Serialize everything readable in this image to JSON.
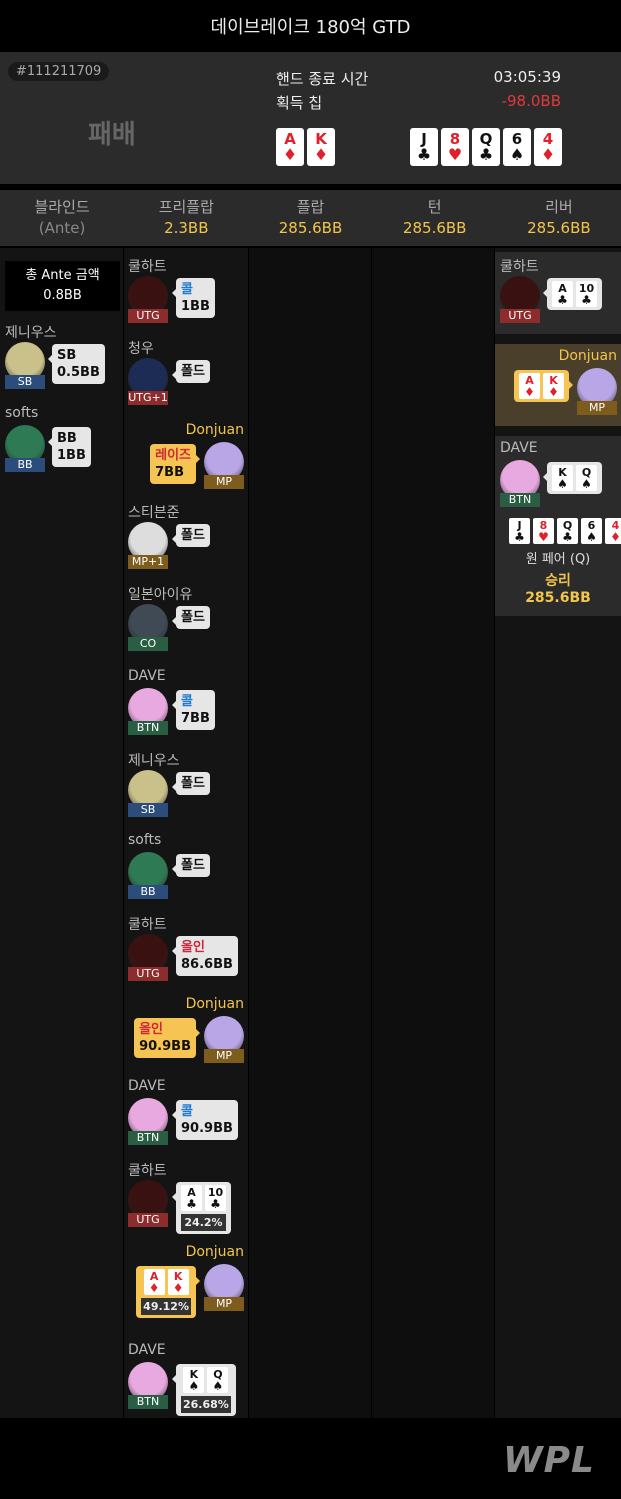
{
  "header": {
    "title": "데이브레이크 180억 GTD"
  },
  "summary": {
    "hand_id": "#111211709",
    "result": "패배",
    "end_time_label": "핸드 종료 시간",
    "end_time": "03:05:39",
    "chips_label": "획득 칩",
    "chips": "-98.0BB",
    "hole_cards": [
      {
        "rank": "A",
        "suit": "♦",
        "color": "red"
      },
      {
        "rank": "K",
        "suit": "♦",
        "color": "red"
      }
    ],
    "board": [
      {
        "rank": "J",
        "suit": "♣",
        "color": "black"
      },
      {
        "rank": "8",
        "suit": "♥",
        "color": "red"
      },
      {
        "rank": "Q",
        "suit": "♣",
        "color": "black"
      },
      {
        "rank": "6",
        "suit": "♠",
        "color": "black"
      },
      {
        "rank": "4",
        "suit": "♦",
        "color": "red"
      }
    ]
  },
  "streets": [
    {
      "name": "블라인드",
      "amount": "(Ante)"
    },
    {
      "name": "프리플랍",
      "amount": "2.3BB"
    },
    {
      "name": "플랍",
      "amount": "285.6BB"
    },
    {
      "name": "턴",
      "amount": "285.6BB"
    },
    {
      "name": "리버",
      "amount": "285.6BB"
    }
  ],
  "blinds": {
    "ante_label": "총 Ante 금액",
    "ante_value": "0.8BB",
    "players": [
      {
        "name": "제니우스",
        "pos": "SB",
        "action": "SB",
        "amount": "0.5BB"
      },
      {
        "name": "softs",
        "pos": "BB",
        "action": "BB",
        "amount": "1BB"
      }
    ]
  },
  "preflop": [
    {
      "name": "쿨하트",
      "pos": "UTG",
      "action": "콜",
      "amount": "1BB"
    },
    {
      "name": "청우",
      "pos": "UTG+1",
      "action": "폴드",
      "amount": ""
    },
    {
      "name": "Donjuan",
      "pos": "MP",
      "action": "레이즈",
      "amount": "7BB"
    },
    {
      "name": "스티븐준",
      "pos": "MP+1",
      "action": "폴드",
      "amount": ""
    },
    {
      "name": "일본아이유",
      "pos": "CO",
      "action": "폴드",
      "amount": ""
    },
    {
      "name": "DAVE",
      "pos": "BTN",
      "action": "콜",
      "amount": "7BB"
    },
    {
      "name": "제니우스",
      "pos": "SB",
      "action": "폴드",
      "amount": ""
    },
    {
      "name": "softs",
      "pos": "BB",
      "action": "폴드",
      "amount": ""
    },
    {
      "name": "쿨하트",
      "pos": "UTG",
      "action": "올인",
      "amount": "86.6BB"
    },
    {
      "name": "Donjuan",
      "pos": "MP",
      "action": "올인",
      "amount": "90.9BB"
    },
    {
      "name": "DAVE",
      "pos": "BTN",
      "action": "콜",
      "amount": "90.9BB"
    },
    {
      "name": "쿨하트",
      "pos": "UTG",
      "equity": "24.2%",
      "cards": [
        {
          "rank": "A",
          "suit": "♣",
          "color": "black"
        },
        {
          "rank": "10",
          "suit": "♣",
          "color": "black"
        }
      ]
    },
    {
      "name": "Donjuan",
      "pos": "MP",
      "equity": "49.12%",
      "cards": [
        {
          "rank": "A",
          "suit": "♦",
          "color": "red"
        },
        {
          "rank": "K",
          "suit": "♦",
          "color": "red"
        }
      ]
    },
    {
      "name": "DAVE",
      "pos": "BTN",
      "equity": "26.68%",
      "cards": [
        {
          "rank": "K",
          "suit": "♠",
          "color": "black"
        },
        {
          "rank": "Q",
          "suit": "♠",
          "color": "black"
        }
      ]
    }
  ],
  "river": {
    "players": [
      {
        "name": "쿨하트",
        "pos": "UTG",
        "cards": [
          {
            "rank": "A",
            "suit": "♣",
            "color": "black"
          },
          {
            "rank": "10",
            "suit": "♣",
            "color": "black"
          }
        ]
      },
      {
        "name": "Donjuan",
        "pos": "MP",
        "cards": [
          {
            "rank": "A",
            "suit": "♦",
            "color": "red"
          },
          {
            "rank": "K",
            "suit": "♦",
            "color": "red"
          }
        ]
      },
      {
        "name": "DAVE",
        "pos": "BTN",
        "cards": [
          {
            "rank": "K",
            "suit": "♠",
            "color": "black"
          },
          {
            "rank": "Q",
            "suit": "♠",
            "color": "black"
          }
        ]
      }
    ],
    "winner_hand": "원 페어 (Q)",
    "winner_result": "승리",
    "winner_amount": "285.6BB"
  },
  "footer": {
    "logo": "WPL"
  }
}
